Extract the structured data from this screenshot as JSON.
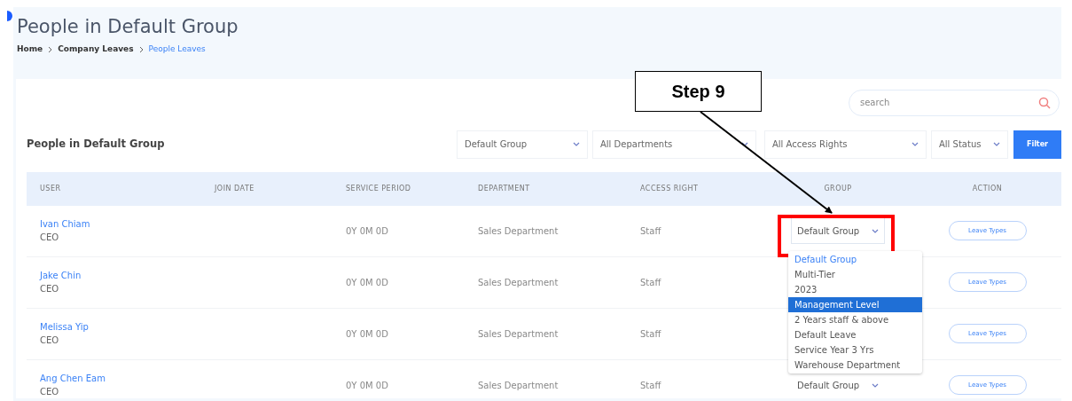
{
  "page": {
    "title": "People in Default Group",
    "breadcrumb": [
      {
        "label": "Home",
        "current": false
      },
      {
        "label": "Company Leaves",
        "current": false
      },
      {
        "label": "People Leaves",
        "current": true
      }
    ]
  },
  "card": {
    "title": "People in Default Group",
    "search": {
      "placeholder": "search"
    },
    "filters": [
      {
        "value": "Default Group"
      },
      {
        "value": "All Departments"
      },
      {
        "value": "All Access Rights"
      },
      {
        "value": "All Status"
      }
    ],
    "filter_button": "Filter"
  },
  "table": {
    "columns": [
      "USER",
      "JOIN DATE",
      "SERVICE PERIOD",
      "DEPARTMENT",
      "ACCESS RIGHT",
      "GROUP",
      "ACTION"
    ],
    "rows": [
      {
        "name": "Ivan Chiam",
        "role": "CEO",
        "service_period": "0Y 0M 0D",
        "department": "Sales Department",
        "access_right": "Staff",
        "group": "Default Group",
        "action": "Leave Types"
      },
      {
        "name": "Jake Chin",
        "role": "CEO",
        "service_period": "0Y 0M 0D",
        "department": "Sales Department",
        "access_right": "Staff",
        "action": "Leave Types"
      },
      {
        "name": "Melissa Yip",
        "role": "CEO",
        "service_period": "0Y 0M 0D",
        "department": "Sales Department",
        "access_right": "Staff",
        "action": "Leave Types"
      },
      {
        "name": "Ang Chen Eam",
        "role": "CEO",
        "service_period": "0Y 0M 0D",
        "department": "Sales Department",
        "access_right": "Staff",
        "group": "Default Group",
        "action": "Leave Types"
      }
    ]
  },
  "group_dropdown": {
    "options": [
      {
        "label": "Default Group",
        "current": true,
        "selected": false
      },
      {
        "label": "Multi-Tier",
        "current": false,
        "selected": false
      },
      {
        "label": "2023",
        "current": false,
        "selected": false
      },
      {
        "label": "Management Level",
        "current": false,
        "selected": true
      },
      {
        "label": "2 Years staff & above",
        "current": false,
        "selected": false
      },
      {
        "label": "Default Leave",
        "current": false,
        "selected": false
      },
      {
        "label": "Service Year 3 Yrs",
        "current": false,
        "selected": false
      },
      {
        "label": "Warehouse Department",
        "current": false,
        "selected": false
      }
    ]
  },
  "annotation": {
    "label": "Step 9"
  }
}
